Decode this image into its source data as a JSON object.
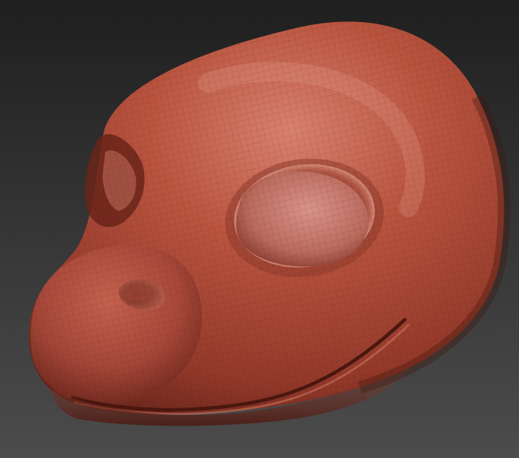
{
  "viewport": {
    "background_top": "#1f1f1f",
    "background_bottom": "#4c4c4c"
  },
  "model": {
    "subject": "sculpted-creature-head",
    "material_color": "#b0503f",
    "shadow_color": "#5a2016",
    "highlight_color": "#e29a88",
    "wireframe_visible": true
  }
}
